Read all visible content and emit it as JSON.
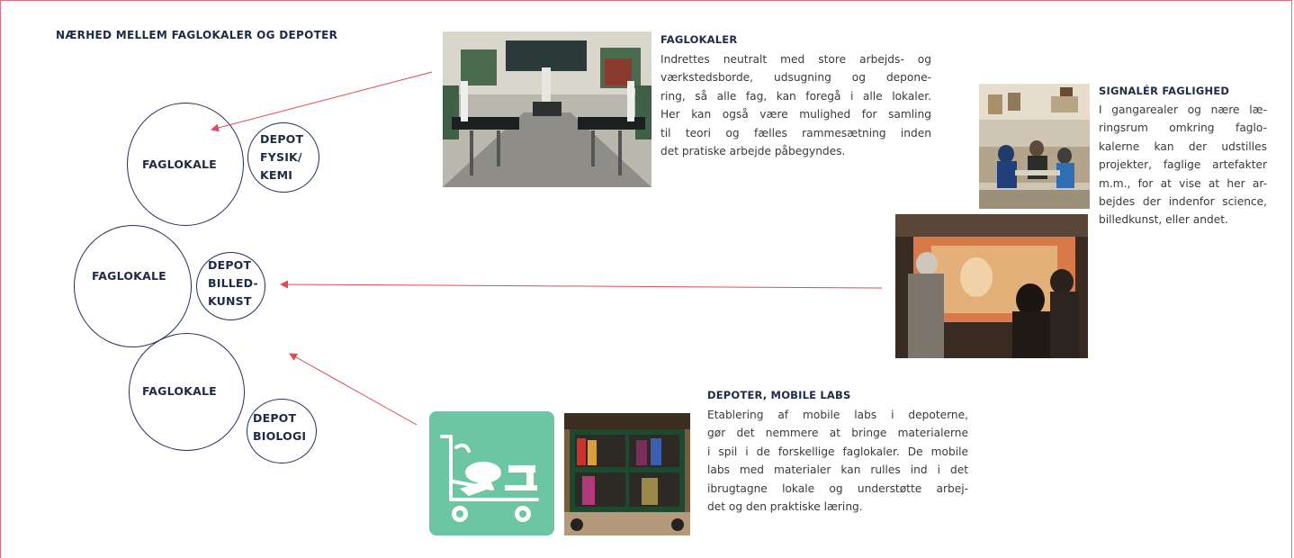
{
  "title": "NÆRHED MELLEM FAGLOKALER OG DEPOTER",
  "diagram": {
    "rooms": [
      {
        "label": "FAGLOKALE",
        "depot_lines": [
          "DEPOT",
          "FYSIK/",
          "KEMI"
        ]
      },
      {
        "label": "FAGLOKALE",
        "depot_lines": [
          "DEPOT",
          "BILLED-",
          "KUNST"
        ]
      },
      {
        "label": "FAGLOKALE",
        "depot_lines": [
          "DEPOT",
          "BIOLOGI"
        ]
      }
    ],
    "arrow_color": "#e04a57",
    "circle_color": "#22305a"
  },
  "sections": {
    "faglokaler": {
      "heading": "FAGLOKALER",
      "lines": [
        "Indrettes neutralt med store arbejds- og",
        "værkstedsborde, udsugning og depone-",
        "ring, så alle fag, kan foregå i alle lokaler.",
        "Her kan også være mulighed for samling",
        "til teori og fælles rammesætning inden",
        "det pratiske arbejde påbegyndes."
      ]
    },
    "signaler": {
      "heading": "SIGNALÉR FAGLIGHED",
      "lines": [
        "I gangarealer og nære læ-",
        "ringsrum omkring faglo-",
        "kalerne kan der udstilles",
        "projekter, faglige artefakter",
        "m.m., for at vise at her ar-",
        "bejdes der indenfor science,",
        "billedkunst, eller andet."
      ]
    },
    "depoter": {
      "heading": "DEPOTER, MOBILE LABS",
      "lines": [
        "Etablering af mobile labs i depoterne,",
        "gør det nemmere at bringe materialerne",
        "i spil i de forskellige faglokaler. De mobile",
        "labs med materialer kan rulles ind i det",
        "ibrugtagne lokale og understøtte arbej-",
        "det og den praktiske læring."
      ]
    }
  },
  "colors": {
    "accent_green": "#6cc5a3",
    "frame_border": "#e0707f",
    "text_navy": "#1f2a44"
  },
  "icons": {
    "mobile_lab": "cart-with-sewing-machine-icon"
  }
}
